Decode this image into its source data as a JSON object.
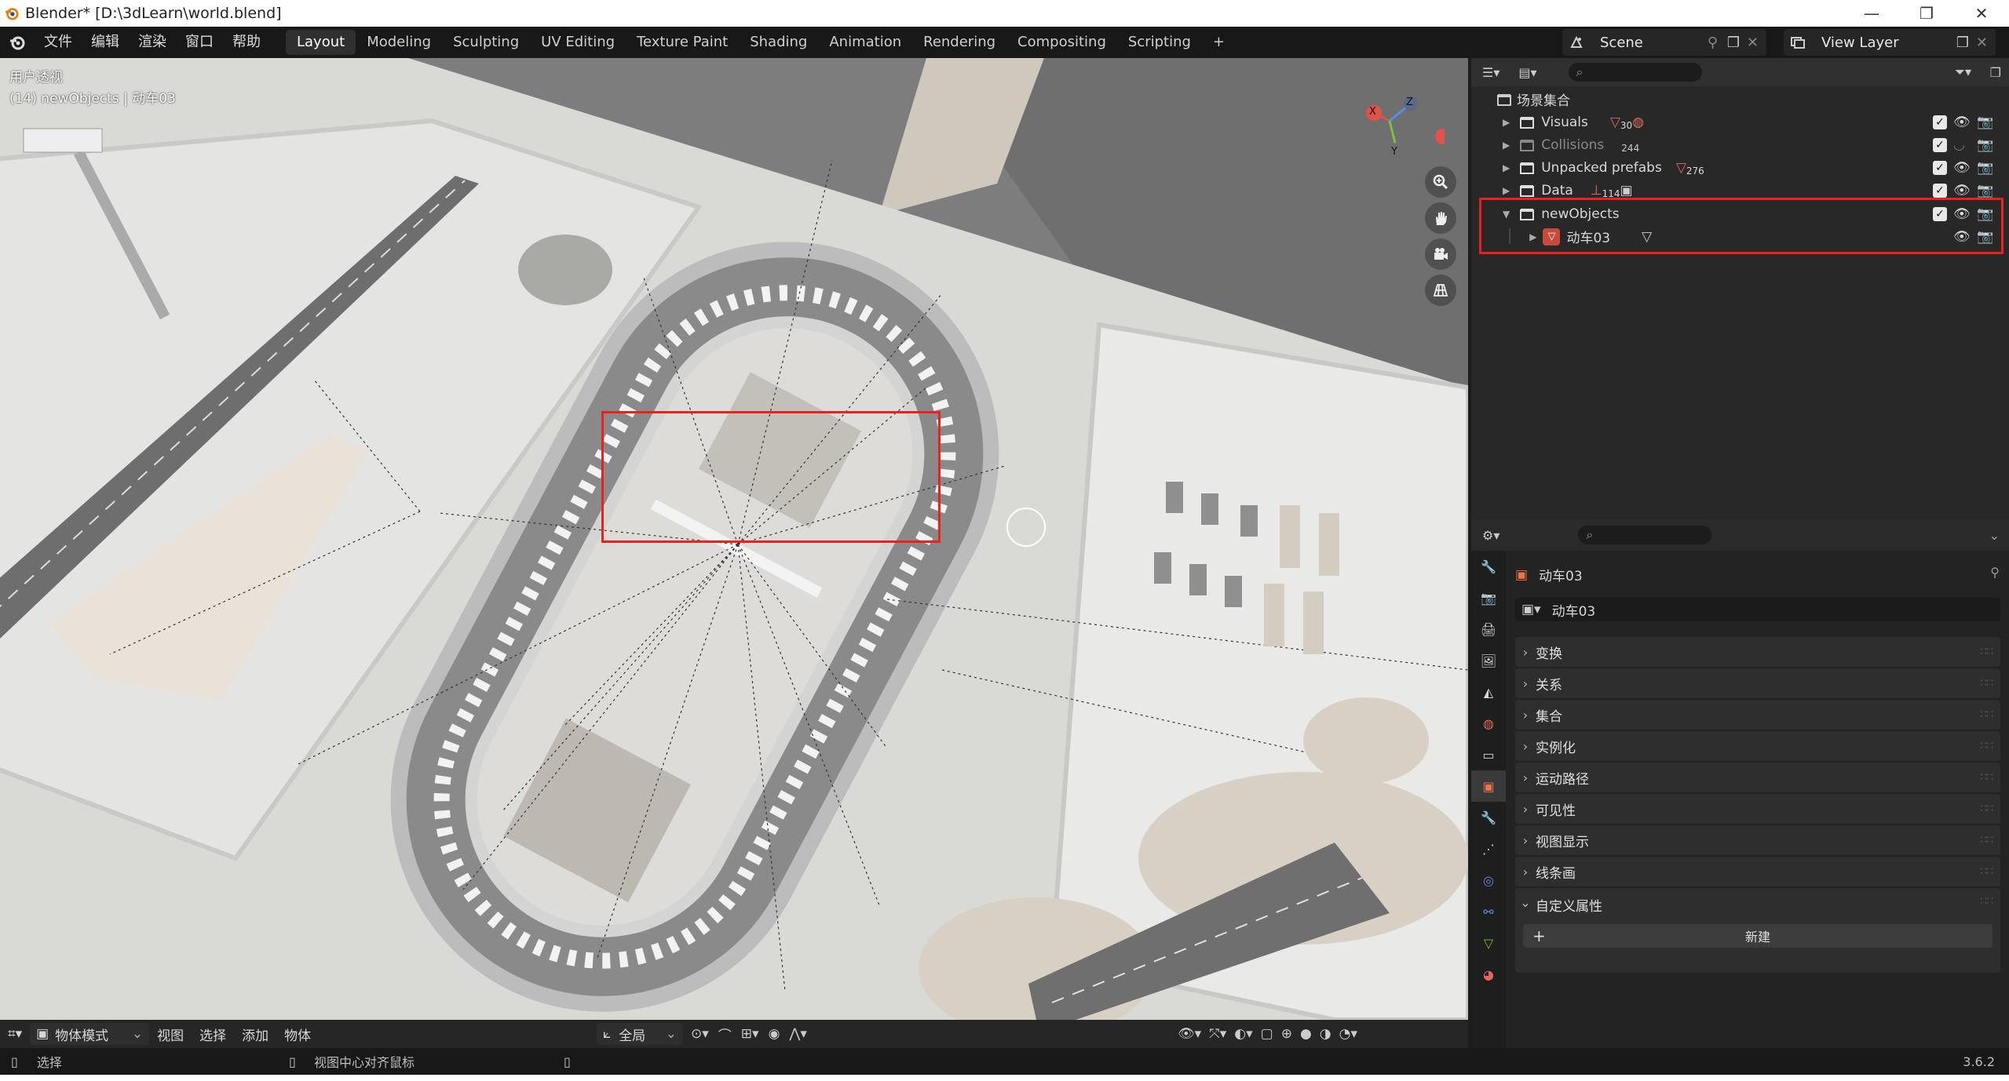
{
  "window": {
    "title": "Blender* [D:\\3dLearn\\world.blend]",
    "min": "—",
    "max": "❐",
    "close": "✕"
  },
  "menu": [
    "文件",
    "编辑",
    "渲染",
    "窗口",
    "帮助"
  ],
  "workspaces": {
    "active": "Layout",
    "tabs": [
      "Layout",
      "Modeling",
      "Sculpting",
      "UV Editing",
      "Texture Paint",
      "Shading",
      "Animation",
      "Rendering",
      "Compositing",
      "Scripting"
    ],
    "add": "+"
  },
  "scene": {
    "name": "Scene",
    "view_layer": "View Layer"
  },
  "viewport": {
    "mode_label": "用户透视",
    "context_label": "(14) newObjects | 动车03",
    "gizmo": {
      "x": "X",
      "y": "Y",
      "z": "Z"
    }
  },
  "viewport_header": {
    "mode": "物体模式",
    "menus": [
      "视图",
      "选择",
      "添加",
      "物体"
    ],
    "transform_orientation": "全局"
  },
  "outliner": {
    "root": "场景集合",
    "collections": [
      {
        "name": "Visuals",
        "badge": "30",
        "dim": false
      },
      {
        "name": "Collisions",
        "badge": "244",
        "dim": true
      },
      {
        "name": "Unpacked prefabs",
        "badge": "276",
        "dim": false
      },
      {
        "name": "Data",
        "badge": "114",
        "dim": false
      },
      {
        "name": "newObjects",
        "badge": "",
        "dim": false
      }
    ],
    "child": {
      "name": "动车03"
    }
  },
  "properties": {
    "object_name": "动车03",
    "object_field": "动车03",
    "panels": [
      "变换",
      "关系",
      "集合",
      "实例化",
      "运动路径",
      "可见性",
      "视图显示",
      "线条画",
      "自定义属性"
    ],
    "new_button": "新建",
    "add_symbol": "+"
  },
  "statusbar": {
    "select": "选择",
    "center_view": "视图中心对齐鼠标",
    "version": "3.6.2"
  },
  "colors": {
    "highlight_box": "#e8221e",
    "panel_bg": "#2e2e2e",
    "viewport_ground": "#dcdcd8"
  }
}
